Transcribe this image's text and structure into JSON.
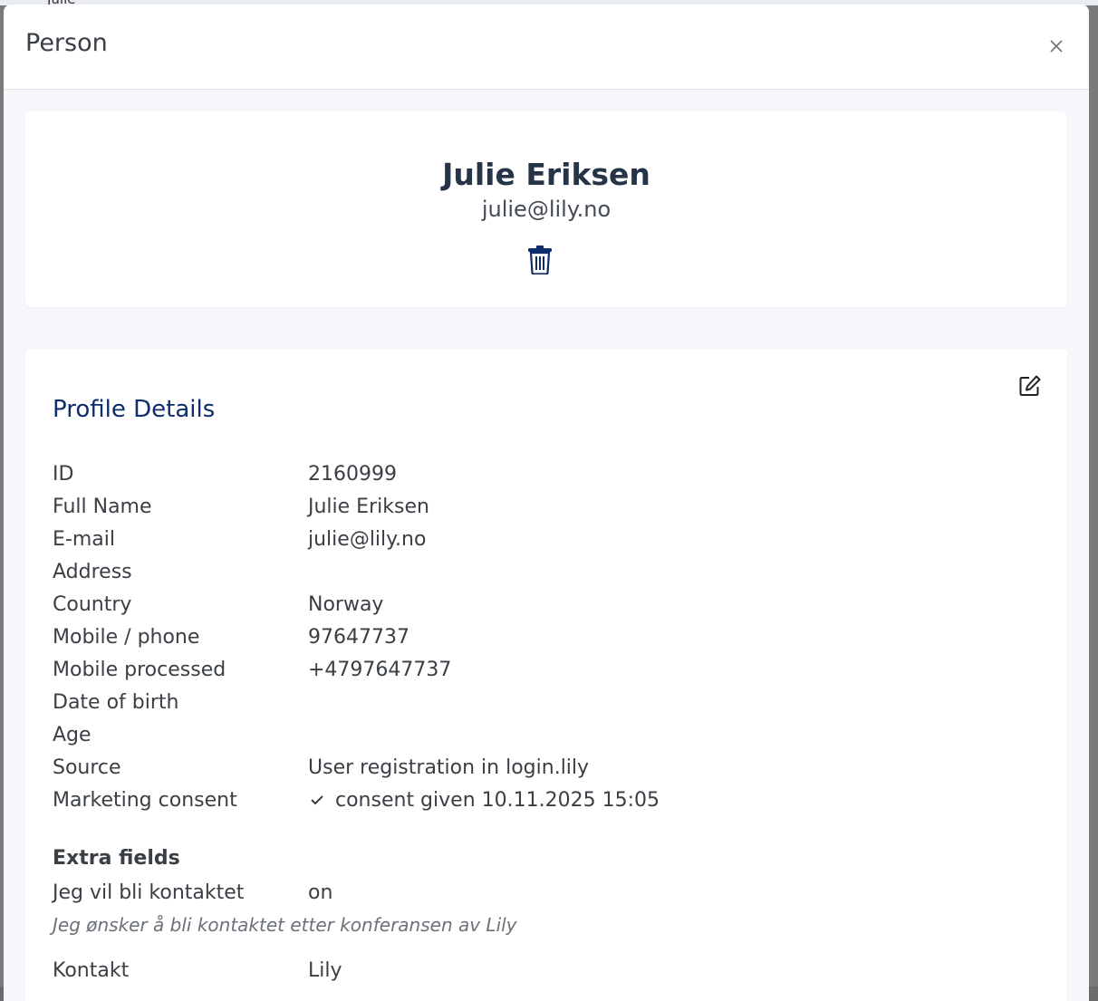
{
  "background": {
    "partial_text": "Julie"
  },
  "modal": {
    "title": "Person",
    "close_label": "×"
  },
  "profile": {
    "name": "Julie Eriksen",
    "email": "julie@lily.no"
  },
  "details": {
    "title": "Profile Details",
    "rows": [
      {
        "label": "ID",
        "value": "2160999"
      },
      {
        "label": "Full Name",
        "value": "Julie Eriksen"
      },
      {
        "label": "E-mail",
        "value": "julie@lily.no"
      },
      {
        "label": "Address",
        "value": ""
      },
      {
        "label": "Country",
        "value": "Norway"
      },
      {
        "label": "Mobile / phone",
        "value": "97647737"
      },
      {
        "label": "Mobile processed",
        "value": "+4797647737"
      },
      {
        "label": "Date of birth",
        "value": ""
      },
      {
        "label": "Age",
        "value": ""
      },
      {
        "label": "Source",
        "value": "User registration in login.lily"
      },
      {
        "label": "Marketing consent",
        "value": "consent given 10.11.2025 15:05"
      }
    ],
    "extra_title": "Extra fields",
    "extra": [
      {
        "label": "Jeg vil bli kontaktet",
        "value": "on",
        "hint": "Jeg ønsker å bli kontaktet etter konferansen av Lily"
      },
      {
        "label": "Kontakt",
        "value": "Lily"
      }
    ]
  },
  "icons": {
    "close": "close-icon",
    "trash": "trash-icon",
    "edit": "edit-icon",
    "check": "check-icon"
  },
  "colors": {
    "accent": "#0f2d6b",
    "heading": "#263447",
    "text": "#3a3f45",
    "body_bg": "#f6f7fb"
  }
}
